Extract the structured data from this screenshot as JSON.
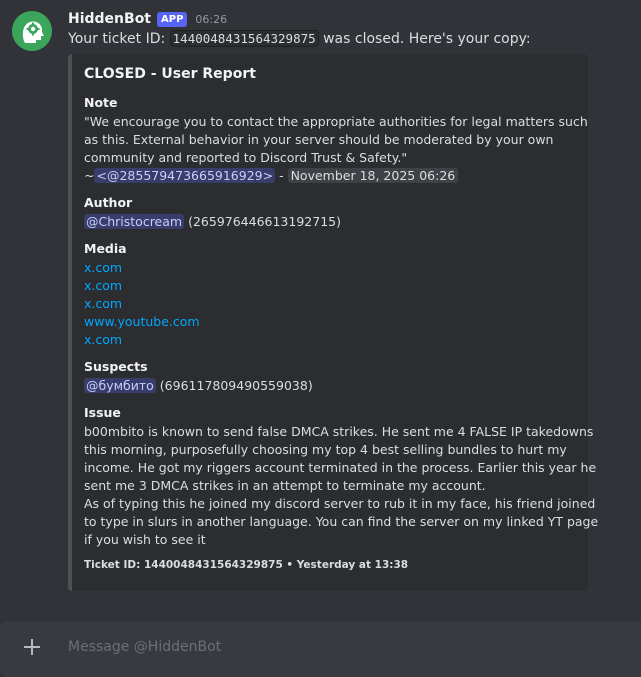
{
  "message": {
    "username": "HiddenBot",
    "badge": "APP",
    "timestamp": "06:26",
    "text_prefix": "Your ticket ID:",
    "ticket_id": "1440048431564329875",
    "text_suffix": "was closed. Here's your copy:",
    "avatar_icon": "bot-head-gear-icon"
  },
  "embed": {
    "title": "CLOSED - User Report",
    "fields": {
      "note": {
        "name": "Note",
        "lines": [
          "\"We encourage you to contact the appropriate authorities for legal matters such",
          "as this. External behavior in your server should be moderated by your own",
          "community and reported to Discord Trust & Safety.\""
        ],
        "signature_prefix": "~",
        "signature_mention": "<@285579473665916929>",
        "signature_sep": "-",
        "signature_date": "November 18, 2025 06:26"
      },
      "author": {
        "name": "Author",
        "mention": "@Christocream",
        "id": "(265976446613192715)"
      },
      "media": {
        "name": "Media",
        "links": [
          "x.com",
          "x.com",
          "x.com",
          "www.youtube.com",
          "x.com"
        ]
      },
      "suspects": {
        "name": "Suspects",
        "mention": "@бумбито",
        "id": "(696117809490559038)"
      },
      "issue": {
        "name": "Issue",
        "lines": [
          "b00mbito is known to send false DMCA strikes. He sent me 4 FALSE IP takedowns",
          "this morning, purposefully choosing my top 4 best selling bundles to hurt my",
          "income. He got my riggers account terminated in the process. Earlier this year he",
          "sent me 3 DMCA strikes in an attempt to terminate my account.",
          "As of typing this he joined my discord server to rub it in my face, his friend joined",
          "to type in slurs in another language. You can find the server on my linked YT page",
          "if you wish to see it"
        ]
      }
    },
    "footer": "Ticket ID: 1440048431564329875 • Yesterday at 13:38"
  },
  "composer": {
    "placeholder": "Message @HiddenBot",
    "plus_icon": "plus-icon"
  },
  "colors": {
    "background": "#313338",
    "embed_bg": "#2b2d31",
    "accent": "#5865f2",
    "link": "#00a8fc"
  }
}
